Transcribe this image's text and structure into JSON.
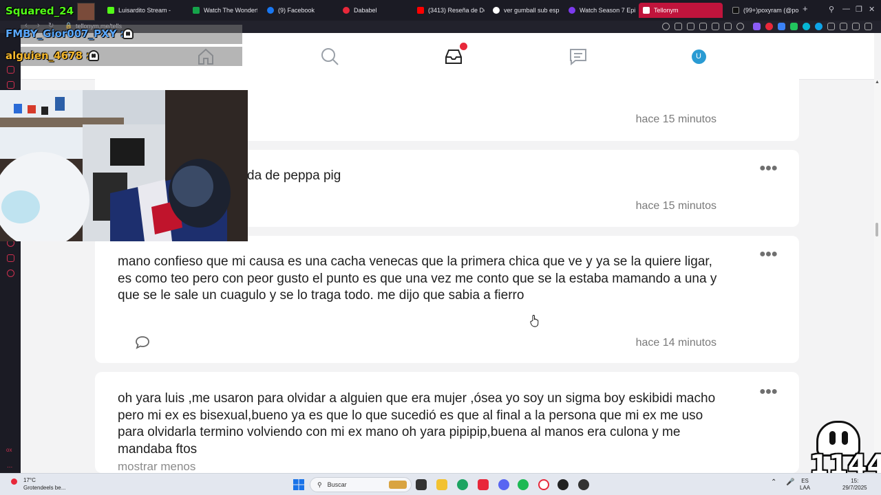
{
  "browser": {
    "tabs": [
      {
        "label": "...",
        "color": "#a0522d"
      },
      {
        "label": "Luisardito Stream - ",
        "color": "#53fc18"
      },
      {
        "label": "Watch The Wonderf",
        "color": "#15a34a"
      },
      {
        "label": "(9) Facebook",
        "color": "#1877f2"
      },
      {
        "label": "Dababel",
        "color": "#e8283a"
      },
      {
        "label": "(3413) Reseña de De",
        "color": "#ff0000"
      },
      {
        "label": "ver gumball sub esp",
        "color": "#ffffff"
      },
      {
        "label": "Watch Season 7 Epi",
        "color": "#7c3aed"
      },
      {
        "label": "Tellonym",
        "color": "#ffffff"
      },
      {
        "label": "(99+)poxyram (@po",
        "color": "#111111"
      }
    ],
    "new_tab": "+",
    "url": "tellonym.me/tells"
  },
  "site": {
    "nav": {
      "home": "home-icon",
      "search": "search-icon",
      "inbox": "inbox-icon",
      "feed": "feed-icon",
      "avatar_letter": "U"
    },
    "accent": "#e8283a"
  },
  "tells": [
    {
      "text": "",
      "time": "hace 15 minutos"
    },
    {
      "text": "da de peppa pig",
      "time": "hace 15 minutos"
    },
    {
      "text": "mano confieso que mi causa es una cacha venecas que la primera chica que ve y ya se la quiere ligar, es como teo pero con peor gusto el punto es que una vez me conto que se la estaba mamando a una y que se le sale un cuagulo y se lo traga todo. me dijo que sabia a fierro",
      "time": "hace 14 minutos"
    },
    {
      "text": "oh yara luis ,me usaron para olvidar a alguien que era mujer ,ósea yo soy un sigma boy eskibidi macho pero mi ex es bisexual,bueno ya es que lo que sucedió es que al final a la persona que mi ex me uso para olvidarla termino volviendo con mi ex mano oh yara pipipip,buena al manos era culona y me mandaba ftos",
      "show_less": "mostrar menos"
    }
  ],
  "overlay": {
    "streamer": "Squared_24 :",
    "chat_user_1": "FMBY_Gior007_PXY :",
    "chat_user_2": "alguien_4678 :",
    "counter": "1144"
  },
  "taskbar": {
    "weather_temp": "17°C",
    "weather_desc": "Grotendeels be...",
    "search_placeholder": "Buscar",
    "lang_1": "ES",
    "lang_2": "LAA",
    "time": "15:",
    "date": "29/7/2025"
  }
}
